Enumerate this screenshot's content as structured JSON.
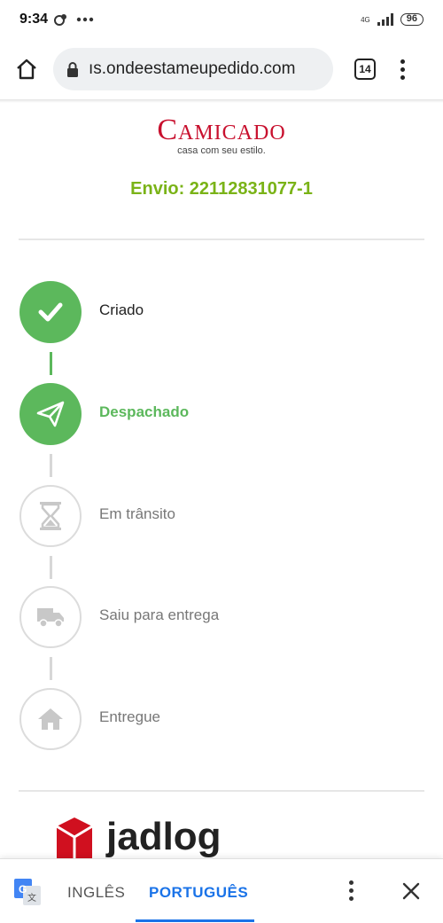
{
  "status_bar": {
    "time": "9:34",
    "network": "4G",
    "battery": "96"
  },
  "browser": {
    "url": "ıs.ondeestameupedido.com",
    "tab_count": "14"
  },
  "page": {
    "brand": {
      "name": "Camicado",
      "tagline": "casa com seu estilo."
    },
    "shipment_label": "Envio: 22112831077-1",
    "steps": [
      {
        "label": "Criado",
        "state": "done",
        "icon": "check-icon"
      },
      {
        "label": "Despachado",
        "state": "active",
        "icon": "paper-plane-icon"
      },
      {
        "label": "Em trânsito",
        "state": "pending",
        "icon": "hourglass-icon"
      },
      {
        "label": "Saiu para entrega",
        "state": "pending",
        "icon": "truck-icon"
      },
      {
        "label": "Entregue",
        "state": "pending",
        "icon": "house-icon"
      }
    ],
    "carrier": {
      "name": "jadlog"
    }
  },
  "translate_bar": {
    "source_lang": "INGLÊS",
    "target_lang": "PORTUGUÊS"
  },
  "colors": {
    "step_green": "#5cb85c",
    "shipment_green": "#7ab317",
    "brand_red": "#c8102e",
    "translate_blue": "#1a73e8"
  }
}
